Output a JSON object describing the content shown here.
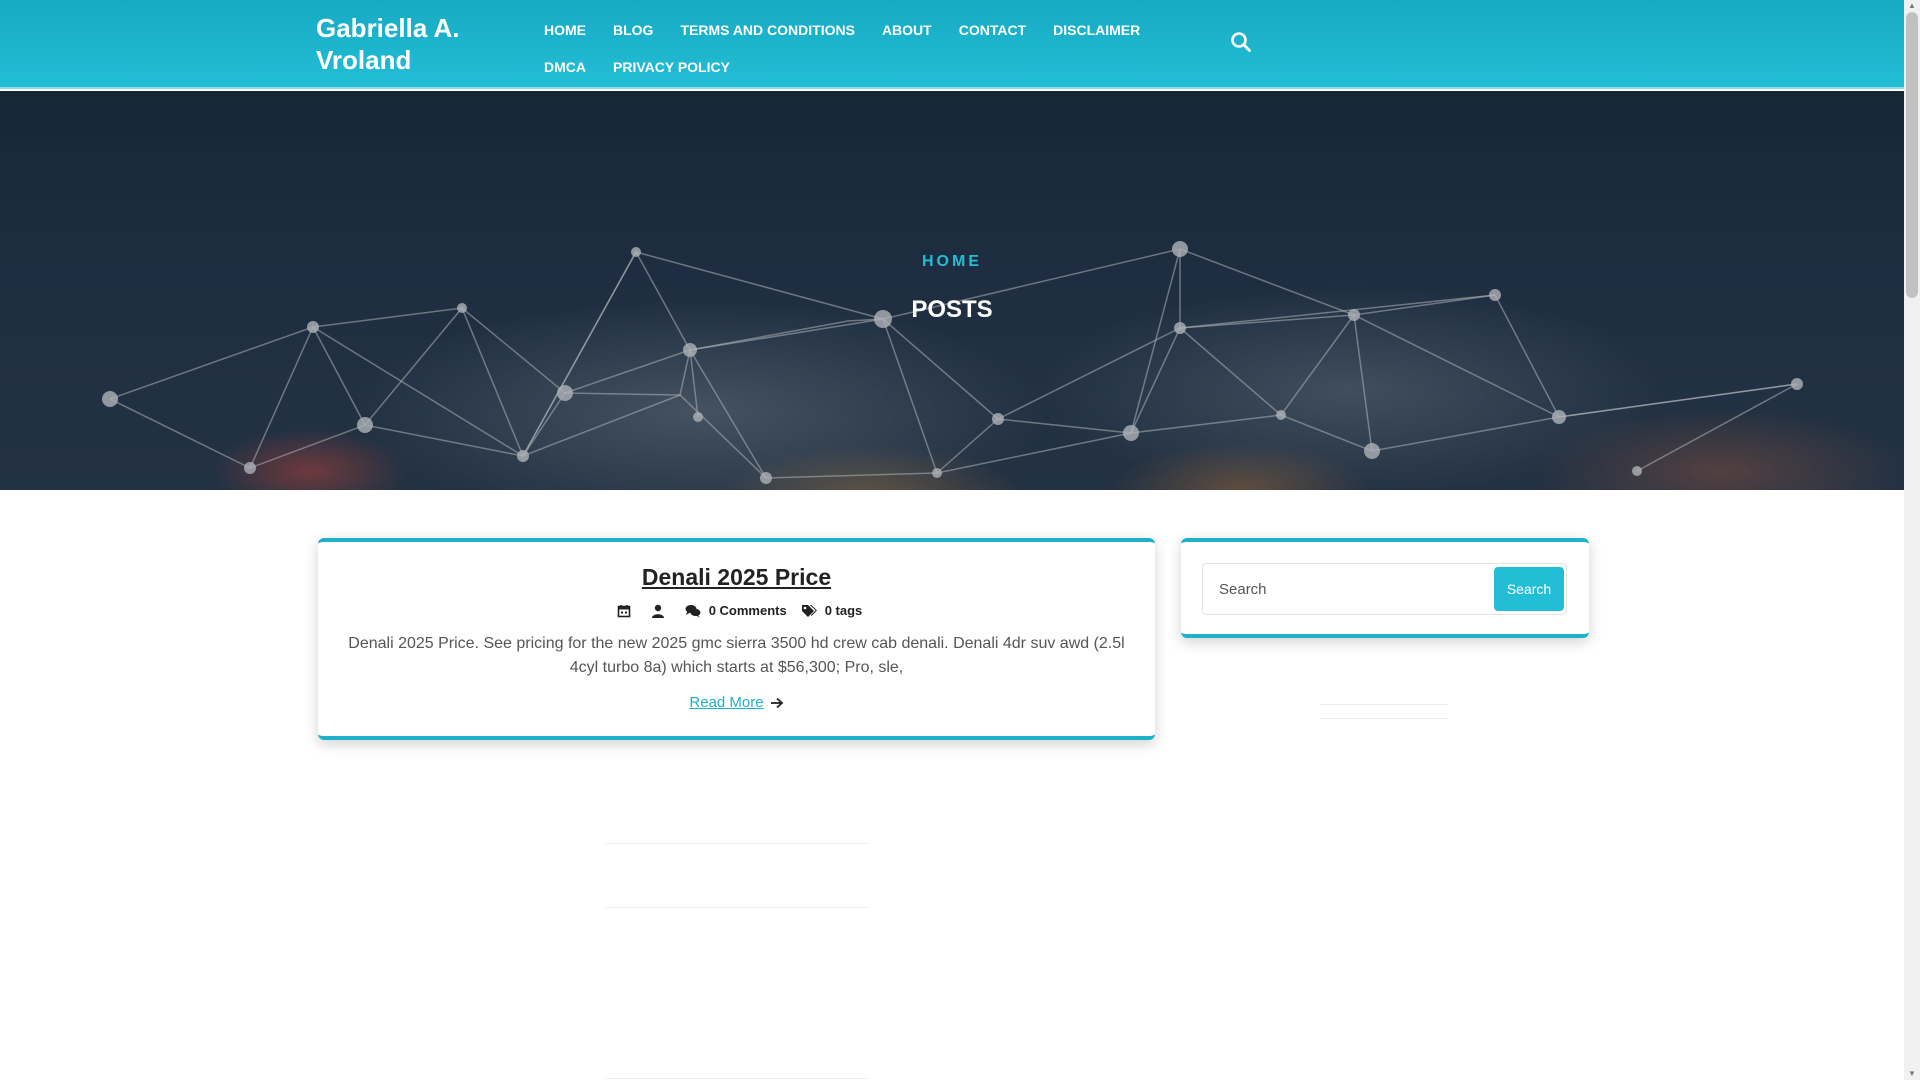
{
  "header": {
    "site_title": "Gabriella A. Vroland",
    "nav_row1": [
      "HOME",
      "BLOG",
      "TERMS AND CONDITIONS",
      "ABOUT",
      "CONTACT",
      "DISCLAIMER"
    ],
    "nav_row2": [
      "DMCA",
      "PRIVACY POLICY"
    ],
    "search_icon": "search-icon"
  },
  "hero": {
    "breadcrumb": "HOME",
    "title": "POSTS"
  },
  "post": {
    "title": "Denali 2025 Price",
    "comments": "0 Comments",
    "tags": "0 tags",
    "excerpt": "Denali 2025 Price. See pricing for the new 2025 gmc sierra 3500 hd crew cab denali. Denali 4dr suv awd (2.5l 4cyl turbo 8a) which starts at $56,300; Pro, sle,",
    "read_more": "Read More"
  },
  "sidebar": {
    "search_placeholder": "Search",
    "search_button": "Search"
  },
  "colors": {
    "accent": "#23bdd6",
    "header_bg": "#17aac3"
  }
}
